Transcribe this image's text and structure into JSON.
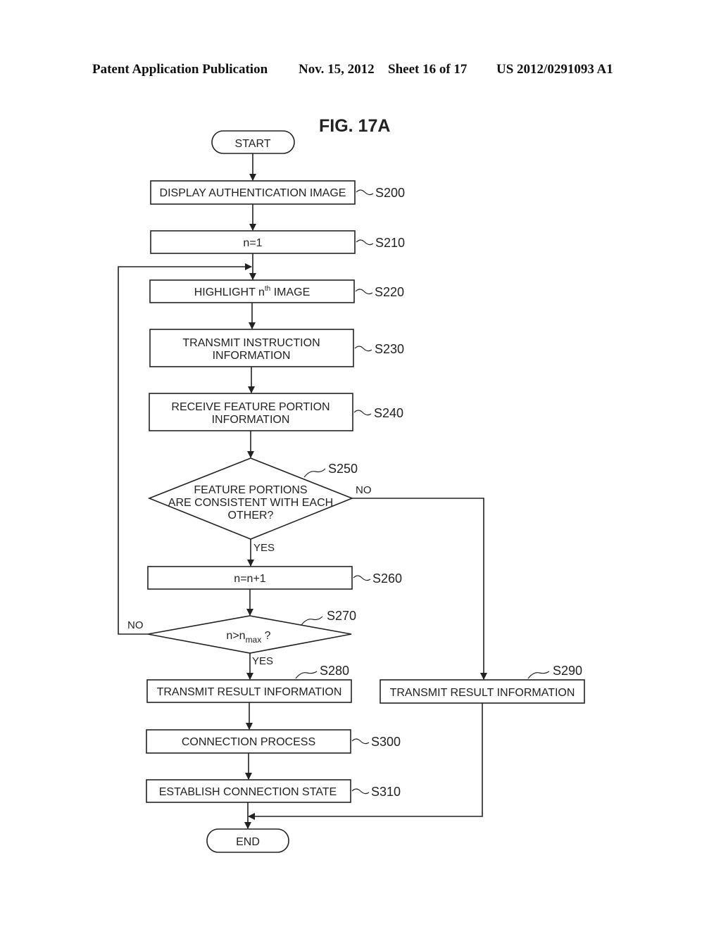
{
  "header": {
    "publication": "Patent Application Publication",
    "date": "Nov. 15, 2012",
    "sheet": "Sheet 16 of 17",
    "number": "US 2012/0291093 A1"
  },
  "figure": {
    "title": "FIG. 17A",
    "start": "START",
    "end": "END",
    "steps": {
      "s200": {
        "id": "S200",
        "text": [
          "DISPLAY AUTHENTICATION IMAGE"
        ]
      },
      "s210": {
        "id": "S210",
        "text": [
          "n=1"
        ]
      },
      "s220": {
        "id": "S220",
        "text_pre": "HIGHLIGHT n",
        "text_sup": "th",
        "text_post": " IMAGE"
      },
      "s230": {
        "id": "S230",
        "text": [
          "TRANSMIT INSTRUCTION",
          "INFORMATION"
        ]
      },
      "s240": {
        "id": "S240",
        "text": [
          "RECEIVE FEATURE PORTION",
          "INFORMATION"
        ]
      },
      "s250": {
        "id": "S250",
        "text": [
          "FEATURE PORTIONS",
          "ARE CONSISTENT WITH EACH",
          "OTHER?"
        ]
      },
      "s260": {
        "id": "S260",
        "text": [
          "n=n+1"
        ]
      },
      "s270": {
        "id": "S270",
        "text_pre": "n>n",
        "text_sub": "max",
        "text_post": " ?"
      },
      "s280": {
        "id": "S280",
        "text": [
          "TRANSMIT RESULT INFORMATION"
        ]
      },
      "s290": {
        "id": "S290",
        "text": [
          "TRANSMIT RESULT INFORMATION"
        ]
      },
      "s300": {
        "id": "S300",
        "text": [
          "CONNECTION PROCESS"
        ]
      },
      "s310": {
        "id": "S310",
        "text": [
          "ESTABLISH CONNECTION STATE"
        ]
      }
    },
    "branch_labels": {
      "s250_yes": "YES",
      "s250_no": "NO",
      "s270_yes": "YES",
      "s270_no": "NO"
    }
  }
}
